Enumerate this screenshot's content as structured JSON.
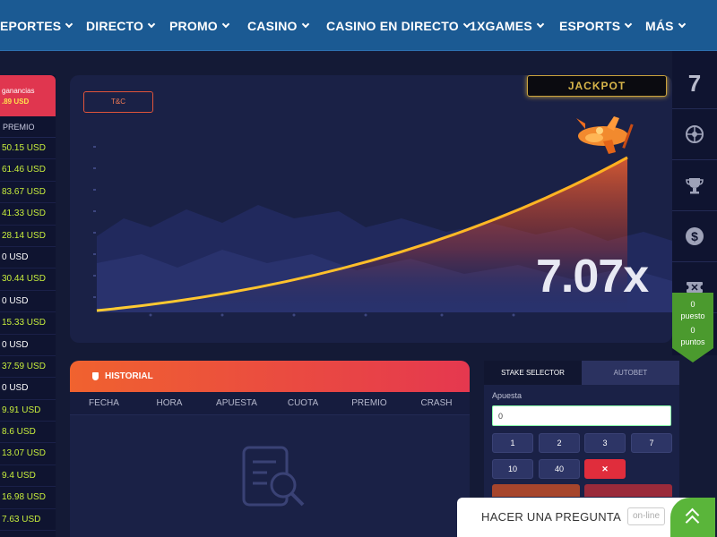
{
  "nav": {
    "items": [
      {
        "label": "EPORTES"
      },
      {
        "label": "DIRECTO"
      },
      {
        "label": "PROMO"
      },
      {
        "label": "CASINO"
      },
      {
        "label": "CASINO EN DIRECTO"
      },
      {
        "label": "1XGAMES"
      },
      {
        "label": "ESPORTS"
      },
      {
        "label": "MÁS"
      }
    ]
  },
  "winners": {
    "header_line1": "ganancias",
    "header_amount": ".89 USD",
    "column_label": "PREMIO",
    "rows": [
      "50.15 USD",
      "61.46 USD",
      "83.67 USD",
      "41.33 USD",
      "28.14 USD",
      "0 USD",
      "30.44 USD",
      "0 USD",
      "15.33 USD",
      "0 USD",
      "37.59 USD",
      "0 USD",
      "9.91 USD",
      "8.6 USD",
      "13.07 USD",
      "9.4 USD",
      "16.98 USD",
      "7.63 USD"
    ]
  },
  "game": {
    "tc_label": "T&C",
    "jackpot_label": "JACKPOT",
    "multiplier": "7.07x",
    "accent_color": "#f0622f"
  },
  "rail": {
    "seven_label": "7",
    "icons": [
      "roulette-icon",
      "trophy-icon",
      "dollar-icon",
      "ticket-icon"
    ],
    "score_puesto_value": "0",
    "score_puesto_label": "puesto",
    "score_puntos_value": "0",
    "score_puntos_label": "puntos"
  },
  "historial": {
    "title": "HISTORIAL",
    "columns": [
      "FECHA",
      "HORA",
      "APUESTA",
      "CUOTA",
      "PREMIO",
      "CRASH"
    ]
  },
  "bet": {
    "tabs": [
      "STAKE SELECTOR",
      "AUTOBET"
    ],
    "apuesta_label": "Apuesta",
    "apuesta_value": "0",
    "chips": [
      "1",
      "2",
      "3",
      "7",
      "10",
      "40"
    ],
    "clear_label": "✕"
  },
  "ask": {
    "text": "HACER UNA PREGUNTA",
    "status": "on-line"
  }
}
